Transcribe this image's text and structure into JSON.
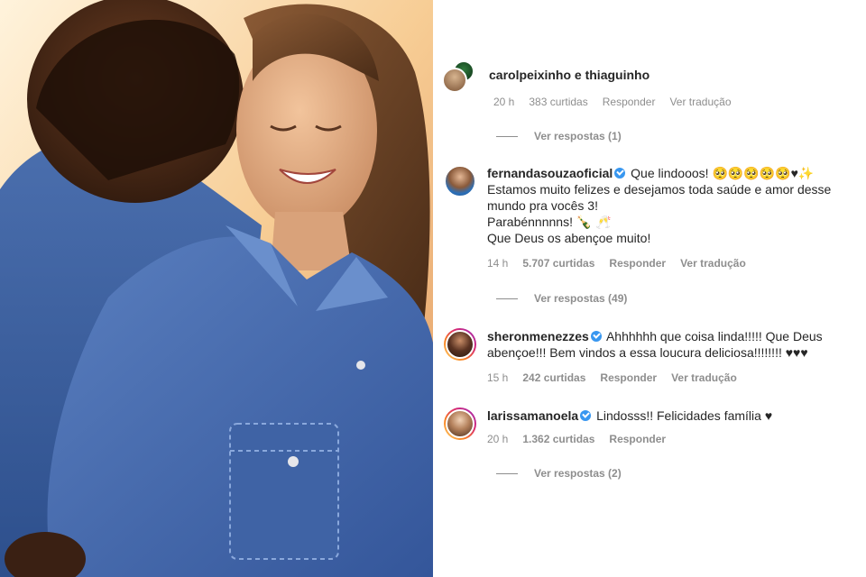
{
  "header": {
    "title": "carolpeixinho e thiaguinho"
  },
  "ghost_meta": {
    "time": "20 h",
    "likes": "383 curtidas",
    "reply": "Responder",
    "translate": "Ver tradução"
  },
  "replies": [
    {
      "label": "Ver respostas (1)"
    },
    {
      "label": "Ver respostas (49)"
    },
    {
      "label": "Ver respostas (2)"
    }
  ],
  "comments": [
    {
      "username": "fernandasouzaoficial",
      "verified": true,
      "text": "Que lindooos! 🥺🥺🥺🥺🥺♥✨ Estamos muito felizes e desejamos toda saúde e amor desse mundo pra vocês 3!",
      "text2": "Parabénnnnns! 🍾 🥂",
      "text3": "Que Deus os abençoe muito!",
      "time": "14 h",
      "likes": "5.707 curtidas",
      "reply": "Responder",
      "translate": "Ver tradução"
    },
    {
      "username": "sheronmenezzes",
      "verified": true,
      "text": "Ahhhhhh que coisa linda!!!!! Que Deus abençoe!!! Bem vindos a essa loucura deliciosa!!!!!!!! ♥♥♥",
      "time": "15 h",
      "likes": "242 curtidas",
      "reply": "Responder",
      "translate": "Ver tradução"
    },
    {
      "username": "larissamanoela",
      "verified": true,
      "text": "Lindosss!! Felicidades família ♥",
      "time": "20 h",
      "likes": "1.362 curtidas",
      "reply": "Responder"
    }
  ],
  "colors": {
    "text": "#262626",
    "muted": "#8e8e8e",
    "verified": "#3897f0",
    "denim": "#3a5f9e"
  }
}
